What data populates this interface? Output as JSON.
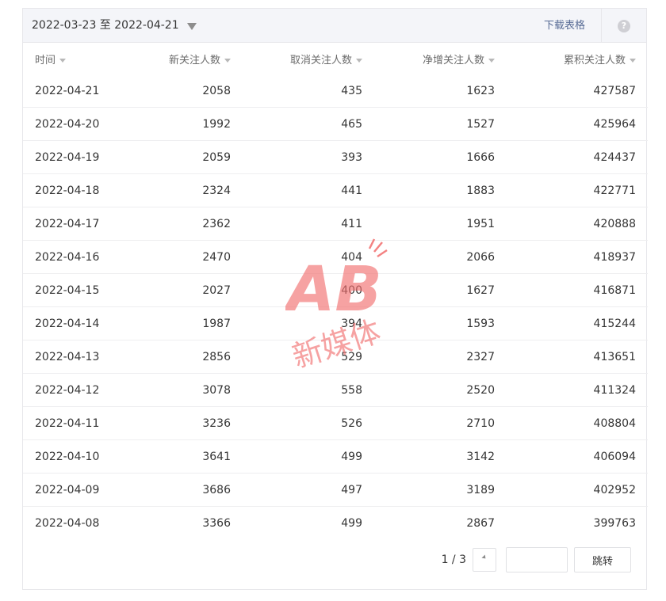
{
  "header": {
    "date_range": "2022-03-23 至 2022-04-21",
    "download_label": "下载表格",
    "help_symbol": "?"
  },
  "table": {
    "columns": [
      "时间",
      "新关注人数",
      "取消关注人数",
      "净增关注人数",
      "累积关注人数"
    ],
    "rows": [
      [
        "2022-04-21",
        "2058",
        "435",
        "1623",
        "427587"
      ],
      [
        "2022-04-20",
        "1992",
        "465",
        "1527",
        "425964"
      ],
      [
        "2022-04-19",
        "2059",
        "393",
        "1666",
        "424437"
      ],
      [
        "2022-04-18",
        "2324",
        "441",
        "1883",
        "422771"
      ],
      [
        "2022-04-17",
        "2362",
        "411",
        "1951",
        "420888"
      ],
      [
        "2022-04-16",
        "2470",
        "404",
        "2066",
        "418937"
      ],
      [
        "2022-04-15",
        "2027",
        "400",
        "1627",
        "416871"
      ],
      [
        "2022-04-14",
        "1987",
        "394",
        "1593",
        "415244"
      ],
      [
        "2022-04-13",
        "2856",
        "529",
        "2327",
        "413651"
      ],
      [
        "2022-04-12",
        "3078",
        "558",
        "2520",
        "411324"
      ],
      [
        "2022-04-11",
        "3236",
        "526",
        "2710",
        "408804"
      ],
      [
        "2022-04-10",
        "3641",
        "499",
        "3142",
        "406094"
      ],
      [
        "2022-04-09",
        "3686",
        "497",
        "3189",
        "402952"
      ],
      [
        "2022-04-08",
        "3366",
        "499",
        "2867",
        "399763"
      ]
    ]
  },
  "pager": {
    "page_info": "1 / 3",
    "jump_input_value": "",
    "jump_label": "跳转"
  },
  "watermark": {
    "logo_text": "AB",
    "caption": "新媒体"
  },
  "colors": {
    "link": "#576b95",
    "header_bg": "#f4f5f9",
    "watermark": "#f26d6d"
  }
}
